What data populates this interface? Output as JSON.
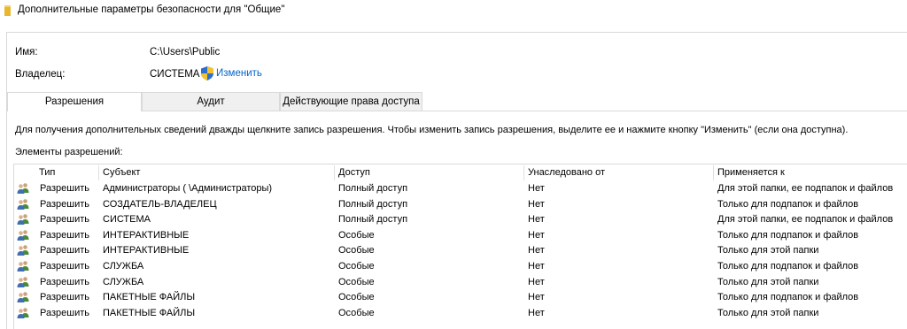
{
  "window": {
    "title": "Дополнительные параметры безопасности  для \"Общие\""
  },
  "owner_section": {
    "name_label": "Имя:",
    "name_value": "C:\\Users\\Public",
    "owner_label": "Владелец:",
    "owner_value": "СИСТЕМА",
    "change_link": "Изменить"
  },
  "tabs": [
    {
      "label": "Разрешения",
      "active": true
    },
    {
      "label": "Аудит",
      "active": false
    },
    {
      "label": "Действующие права доступа",
      "active": false
    }
  ],
  "info_text": "Для получения дополнительных сведений дважды щелкните запись разрешения. Чтобы изменить запись разрешения, выделите ее и нажмите кнопку \"Изменить\" (если она доступна).",
  "elements_label": "Элементы разрешений:",
  "grid": {
    "columns": [
      "Тип",
      "Субъект",
      "Доступ",
      "Унаследовано от",
      "Применяется к"
    ],
    "rows": [
      {
        "type": "Разрешить",
        "subject": "Администраторы (            \\Администраторы)",
        "access": "Полный доступ",
        "inherited": "Нет",
        "applies": "Для этой папки, ее подпапок и файлов"
      },
      {
        "type": "Разрешить",
        "subject": "СОЗДАТЕЛЬ-ВЛАДЕЛЕЦ",
        "access": "Полный доступ",
        "inherited": "Нет",
        "applies": "Только для подпапок и файлов"
      },
      {
        "type": "Разрешить",
        "subject": "СИСТЕМА",
        "access": "Полный доступ",
        "inherited": "Нет",
        "applies": "Для этой папки, ее подпапок и файлов"
      },
      {
        "type": "Разрешить",
        "subject": "ИНТЕРАКТИВНЫЕ",
        "access": "Особые",
        "inherited": "Нет",
        "applies": "Только для подпапок и файлов"
      },
      {
        "type": "Разрешить",
        "subject": "ИНТЕРАКТИВНЫЕ",
        "access": "Особые",
        "inherited": "Нет",
        "applies": "Только для этой папки"
      },
      {
        "type": "Разрешить",
        "subject": "СЛУЖБА",
        "access": "Особые",
        "inherited": "Нет",
        "applies": "Только для подпапок и файлов"
      },
      {
        "type": "Разрешить",
        "subject": "СЛУЖБА",
        "access": "Особые",
        "inherited": "Нет",
        "applies": "Только для этой папки"
      },
      {
        "type": "Разрешить",
        "subject": "ПАКЕТНЫЕ ФАЙЛЫ",
        "access": "Особые",
        "inherited": "Нет",
        "applies": "Только для подпапок и файлов"
      },
      {
        "type": "Разрешить",
        "subject": "ПАКЕТНЫЕ ФАЙЛЫ",
        "access": "Особые",
        "inherited": "Нет",
        "applies": "Только для этой папки"
      }
    ]
  },
  "icons": {
    "folder": "folder-icon",
    "shield": "uac-shield-icon",
    "principal": "users-group-icon"
  },
  "colors": {
    "link": "#0066cc",
    "folder": "#e8b730",
    "shield_blue": "#2d6fcc",
    "shield_yellow": "#f2c230"
  }
}
